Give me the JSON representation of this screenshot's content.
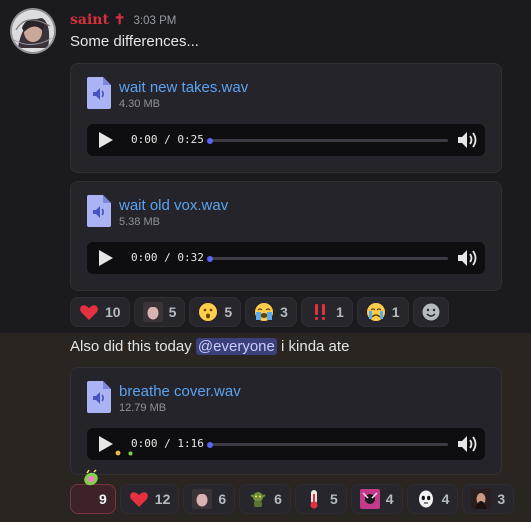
{
  "message1": {
    "username": "saint",
    "username_mark": "✝",
    "timestamp": "3:03 PM",
    "text": "Some differences...",
    "attachments": [
      {
        "filename": "wait new takes.wav",
        "size": "4.30 MB",
        "time": "0:00 / 0:25"
      },
      {
        "filename": "wait old vox.wav",
        "size": "5.38 MB",
        "time": "0:00 / 0:32"
      }
    ],
    "reactions": [
      {
        "icon": "heart",
        "count": "10"
      },
      {
        "icon": "face-photo",
        "count": "5"
      },
      {
        "icon": "astonished-face",
        "count": "5"
      },
      {
        "icon": "loudly-crying-face",
        "count": "3"
      },
      {
        "icon": "double-exclamation",
        "count": "1"
      },
      {
        "icon": "crying-face",
        "count": "1"
      }
    ],
    "add_reaction_icon": "smiley-add"
  },
  "message2": {
    "text_before": "Also did this today",
    "mention": "@everyone",
    "text_after": "i kinda ate",
    "attachment": {
      "filename": "breathe cover.wav",
      "size": "12.79 MB",
      "time": "0:00 / 1:16"
    },
    "reactions": [
      {
        "icon": "custom-emoji-green",
        "count": "9",
        "active": true
      },
      {
        "icon": "heart",
        "count": "12"
      },
      {
        "icon": "face-photo",
        "count": "6"
      },
      {
        "icon": "goblin",
        "count": "6"
      },
      {
        "icon": "thermometer",
        "count": "5"
      },
      {
        "icon": "photo-pink",
        "count": "4"
      },
      {
        "icon": "mask-face",
        "count": "4"
      },
      {
        "icon": "photo-dark",
        "count": "3"
      }
    ]
  },
  "colors": {
    "username": "#d8303a",
    "link": "#5aa3f0",
    "accent": "#5865f2",
    "mention_bg": "#3b3f7a"
  }
}
